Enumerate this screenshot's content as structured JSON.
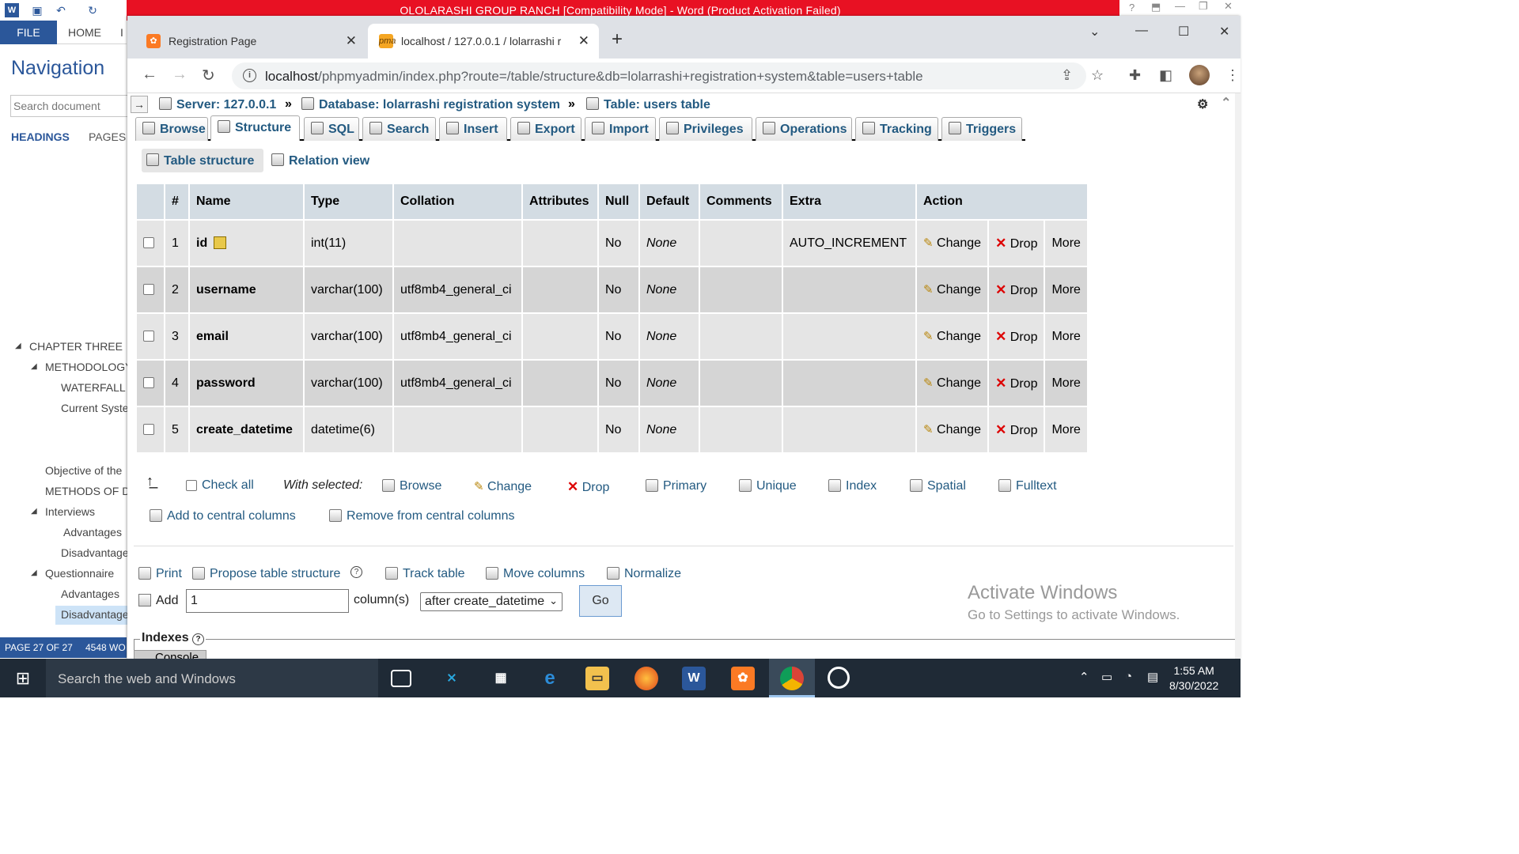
{
  "word": {
    "title": "OLOLARASHI GROUP RANCH [Compatibility Mode] - Word (Product Activation Failed)",
    "file_tab": "FILE",
    "home_tab": "HOME",
    "next_tab": "I",
    "nav_title": "Navigation",
    "search_placeholder": "Search document",
    "tab_headings": "HEADINGS",
    "tab_pages": "PAGES",
    "headings": [
      {
        "label": "CHAPTER THREE",
        "level": 1,
        "expanded": true
      },
      {
        "label": "METHODOLOGY",
        "level": 2,
        "expanded": true
      },
      {
        "label": "WATERFALL M",
        "level": 3
      },
      {
        "label": "Current Syste",
        "level": 3
      },
      {
        "label": "Objective of the",
        "level": 2
      },
      {
        "label": "METHODS OF D",
        "level": 2
      },
      {
        "label": "Interviews",
        "level": 2,
        "expanded": true
      },
      {
        "label": "Advantages",
        "level": 3
      },
      {
        "label": "Disadvantage",
        "level": 3
      },
      {
        "label": "Questionnaire",
        "level": 2,
        "expanded": true
      },
      {
        "label": "Advantages",
        "level": 3
      },
      {
        "label": "Disadvantage",
        "level": 3,
        "selected": true
      }
    ],
    "status_page": "PAGE 27 OF 27",
    "status_words": "4548 WO",
    "ribbon_color": "#2b579a",
    "title_color": "#e81123"
  },
  "browser": {
    "tabs": [
      {
        "title": "Registration Page",
        "active": false,
        "icon": "xampp-icon"
      },
      {
        "title": "localhost / 127.0.0.1 / lolarrashi r",
        "active": true,
        "icon": "phpmyadmin-icon"
      }
    ],
    "url_host": "localhost",
    "url_path": "/phpmyadmin/index.php?route=/table/structure&db=lolarrashi+registration+system&table=users+table"
  },
  "pma": {
    "breadcrumbs": {
      "server": "Server: 127.0.0.1",
      "database": "Database: lolarrashi registration system",
      "table": "Table: users table",
      "separator": "»"
    },
    "main_tabs": [
      {
        "label": "Browse",
        "active": false
      },
      {
        "label": "Structure",
        "active": true
      },
      {
        "label": "SQL",
        "active": false
      },
      {
        "label": "Search",
        "active": false
      },
      {
        "label": "Insert",
        "active": false
      },
      {
        "label": "Export",
        "active": false
      },
      {
        "label": "Import",
        "active": false
      },
      {
        "label": "Privileges",
        "active": false
      },
      {
        "label": "Operations",
        "active": false
      },
      {
        "label": "Tracking",
        "active": false
      },
      {
        "label": "Triggers",
        "active": false
      }
    ],
    "sub_tabs": [
      {
        "label": "Table structure",
        "active": true
      },
      {
        "label": "Relation view",
        "active": false
      }
    ],
    "columns": [
      "#",
      "Name",
      "Type",
      "Collation",
      "Attributes",
      "Null",
      "Default",
      "Comments",
      "Extra",
      "Action"
    ],
    "rows": [
      {
        "num": "1",
        "name": "id",
        "primary": true,
        "type": "int(11)",
        "collation": "",
        "attributes": "",
        "null": "No",
        "default": "None",
        "comments": "",
        "extra": "AUTO_INCREMENT"
      },
      {
        "num": "2",
        "name": "username",
        "primary": false,
        "type": "varchar(100)",
        "collation": "utf8mb4_general_ci",
        "attributes": "",
        "null": "No",
        "default": "None",
        "comments": "",
        "extra": ""
      },
      {
        "num": "3",
        "name": "email",
        "primary": false,
        "type": "varchar(100)",
        "collation": "utf8mb4_general_ci",
        "attributes": "",
        "null": "No",
        "default": "None",
        "comments": "",
        "extra": ""
      },
      {
        "num": "4",
        "name": "password",
        "primary": false,
        "type": "varchar(100)",
        "collation": "utf8mb4_general_ci",
        "attributes": "",
        "null": "No",
        "default": "None",
        "comments": "",
        "extra": ""
      },
      {
        "num": "5",
        "name": "create_datetime",
        "primary": false,
        "type": "datetime(6)",
        "collation": "",
        "attributes": "",
        "null": "No",
        "default": "None",
        "comments": "",
        "extra": ""
      }
    ],
    "row_actions": {
      "change": "Change",
      "drop": "Drop",
      "more": "More"
    },
    "bulk": {
      "check_all": "Check all",
      "with_selected": "With selected:",
      "actions": [
        "Browse",
        "Change",
        "Drop",
        "Primary",
        "Unique",
        "Index",
        "Spatial",
        "Fulltext"
      ],
      "add_central": "Add to central columns",
      "remove_central": "Remove from central columns"
    },
    "tools": {
      "print": "Print",
      "propose": "Propose table structure",
      "track": "Track table",
      "move": "Move columns",
      "normalize": "Normalize"
    },
    "add_columns": {
      "label": "Add",
      "value": "1",
      "unit": "column(s)",
      "position": "after create_datetime",
      "go": "Go"
    },
    "indexes_label": "Indexes",
    "console_label": "Console",
    "link_color": "#235a81",
    "header_bg": "#d3dce3"
  },
  "watermark": {
    "line1": "Activate Windows",
    "line2": "Go to Settings to activate Windows."
  },
  "taskbar": {
    "search": "Search the web and Windows",
    "time": "1:55 AM",
    "date": "8/30/2022"
  }
}
